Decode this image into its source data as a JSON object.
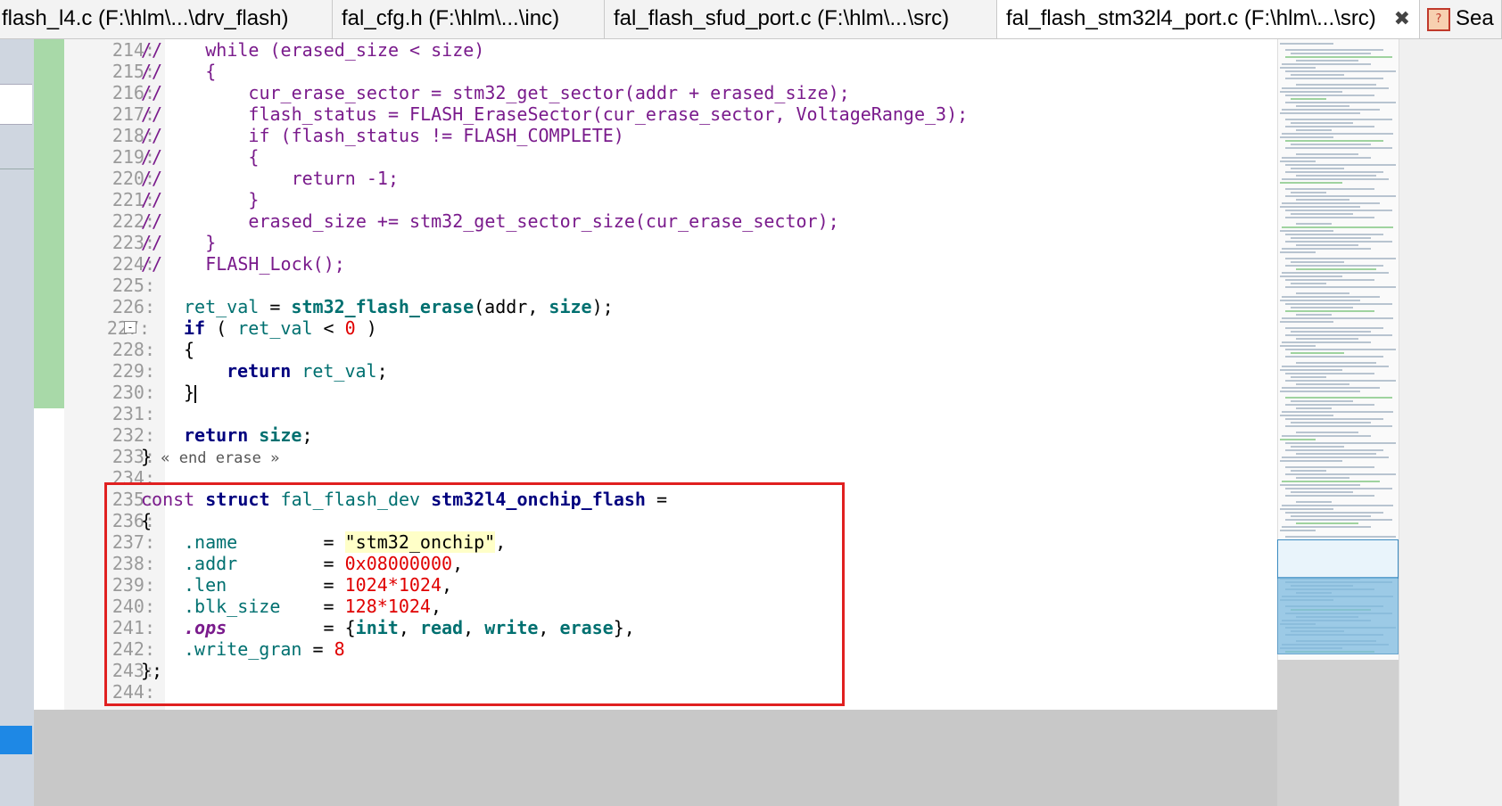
{
  "tabs": [
    {
      "label": "flash_l4.c (F:\\hlm\\...\\drv_flash)",
      "active": false
    },
    {
      "label": "fal_cfg.h (F:\\hlm\\...\\inc)",
      "active": false
    },
    {
      "label": "fal_flash_sfud_port.c (F:\\hlm\\...\\src)",
      "active": false
    },
    {
      "label": "fal_flash_stm32l4_port.c (F:\\hlm\\...\\src)",
      "active": true
    },
    {
      "label": "Sea",
      "active": false
    }
  ],
  "close_glyph": "✖",
  "search_badge": "?",
  "editor": {
    "lines": [
      {
        "n": "214:"
      },
      {
        "n": "215:"
      },
      {
        "n": "216:"
      },
      {
        "n": "217:"
      },
      {
        "n": "218:"
      },
      {
        "n": "219:"
      },
      {
        "n": "220:"
      },
      {
        "n": "221:"
      },
      {
        "n": "222:"
      },
      {
        "n": "223:"
      },
      {
        "n": "224:"
      },
      {
        "n": "225:"
      },
      {
        "n": "226:"
      },
      {
        "n": "227:"
      },
      {
        "n": "228:"
      },
      {
        "n": "229:"
      },
      {
        "n": "230:"
      },
      {
        "n": "231:"
      },
      {
        "n": "232:"
      },
      {
        "n": "233:"
      },
      {
        "n": "234:"
      },
      {
        "n": "235:"
      },
      {
        "n": "236:"
      },
      {
        "n": "237:"
      },
      {
        "n": "238:"
      },
      {
        "n": "239:"
      },
      {
        "n": "240:"
      },
      {
        "n": "241:"
      },
      {
        "n": "242:"
      },
      {
        "n": "243:"
      },
      {
        "n": "244:"
      }
    ],
    "code": {
      "l214": "//    while (erased_size < size)",
      "l215": "//    {",
      "l216": "//        cur_erase_sector = stm32_get_sector(addr + erased_size);",
      "l217": "//        flash_status = FLASH_EraseSector(cur_erase_sector, VoltageRange_3);",
      "l218": "//        if (flash_status != FLASH_COMPLETE)",
      "l219": "//        {",
      "l220": "//            return -1;",
      "l221": "//        }",
      "l222": "//        erased_size += stm32_get_sector_size(cur_erase_sector);",
      "l223": "//    }",
      "l224": "//    FLASH_Lock();",
      "l226_a": "ret_val",
      "l226_b": " = ",
      "l226_c": "stm32_flash_erase",
      "l226_d": "(addr, ",
      "l226_e": "size",
      "l226_f": ");",
      "l227_a": "if",
      "l227_b": " ( ",
      "l227_c": "ret_val",
      "l227_d": " < ",
      "l227_e": "0",
      "l227_f": " )",
      "l228": "{",
      "l229_a": "return",
      "l229_b": " ret_val",
      "l229_c": ";",
      "l230": "}",
      "l232_a": "return",
      "l232_b": " size",
      "l232_c": ";",
      "l233_a": "}",
      "l233_b": " « end erase »",
      "l235_a": "const ",
      "l235_b": "struct",
      "l235_c": " fal_flash_dev ",
      "l235_d": "stm32l4_onchip_flash",
      "l235_e": " =",
      "l236": "{",
      "l237_a": ".name",
      "l237_b": "        = ",
      "l237_c": "\"stm32_onchip\"",
      "l237_d": ",",
      "l238_a": ".addr",
      "l238_b": "        = ",
      "l238_c": "0x08000000",
      "l238_d": ",",
      "l239_a": ".len",
      "l239_b": "         = ",
      "l239_c": "1024",
      "l239_d": "*",
      "l239_e": "1024",
      "l239_f": ",",
      "l240_a": ".blk_size",
      "l240_b": "    = ",
      "l240_c": "128",
      "l240_d": "*",
      "l240_e": "1024",
      "l240_f": ",",
      "l241_a": ".ops",
      "l241_b": "         = {",
      "l241_c": "init",
      "l241_d": ", ",
      "l241_e": "read",
      "l241_f": ", ",
      "l241_g": "write",
      "l241_h": ", ",
      "l241_i": "erase",
      "l241_j": "},",
      "l242_a": ".write_gran",
      "l242_b": " = ",
      "l242_c": "8",
      "l243": "};"
    },
    "fold_glyph": "-"
  }
}
